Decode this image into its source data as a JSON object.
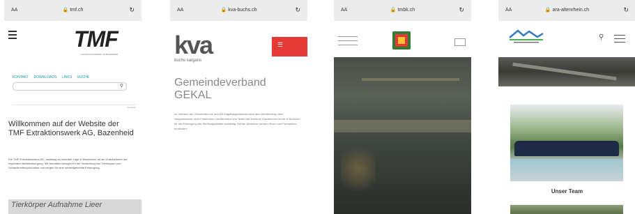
{
  "phones": [
    {
      "url": "tmf.ch",
      "aa": "AA",
      "logo": "TMF",
      "logo_sub": "EXTRAKTIONSWERK AG BAZENHEID",
      "nav": "KONTAKT  DOWNLOADS  LINKS  SUCHE",
      "welcome": "Willkommen auf der Website der TMF Extraktionswerk AG, Bazenheid",
      "crumb": "Startseite",
      "paragraph": "Die TMF Extraktionswerk AG, ansässig an zentraler Lage in Bazenheid, ist ein Unternehmen der regionalen Abfallentsorgung. Wir betreiben Anlagen für die Verwertung von Tierkörpern und Schlachtnebenprodukten und sorgen für eine umweltgerechte Entsorgung.",
      "footer": "Tierkörper Aufnahme Lieer"
    },
    {
      "url": "kva-buchs.ch",
      "aa": "AA",
      "logo_main": "kva",
      "logo_sub": "buchs sargans",
      "flag_label": "Gemeindeverband GEKAL",
      "paragraph": "Im Verband der Gemeinden mit rund 80 Mitgliedsgemeinden aus dem Werdenberg, dem Sarganserland, dem Fürstentum Liechtenstein und Teilen des Kantons Graubünden ist die KVA Buchs für die Entsorgung der Siedlungsabfälle zuständig. Mit der Abwärme werden Strom und Fernwärme produziert."
    },
    {
      "url": "tmbk.ch",
      "aa": "AA"
    },
    {
      "url": "ara-altenrhein.ch",
      "aa": "AA",
      "caption": "Unser Team"
    }
  ],
  "icons": {
    "lock": "lock-icon",
    "reload": "reload-icon",
    "menu": "menu-icon",
    "search": "search-icon",
    "mail": "mail-icon"
  }
}
